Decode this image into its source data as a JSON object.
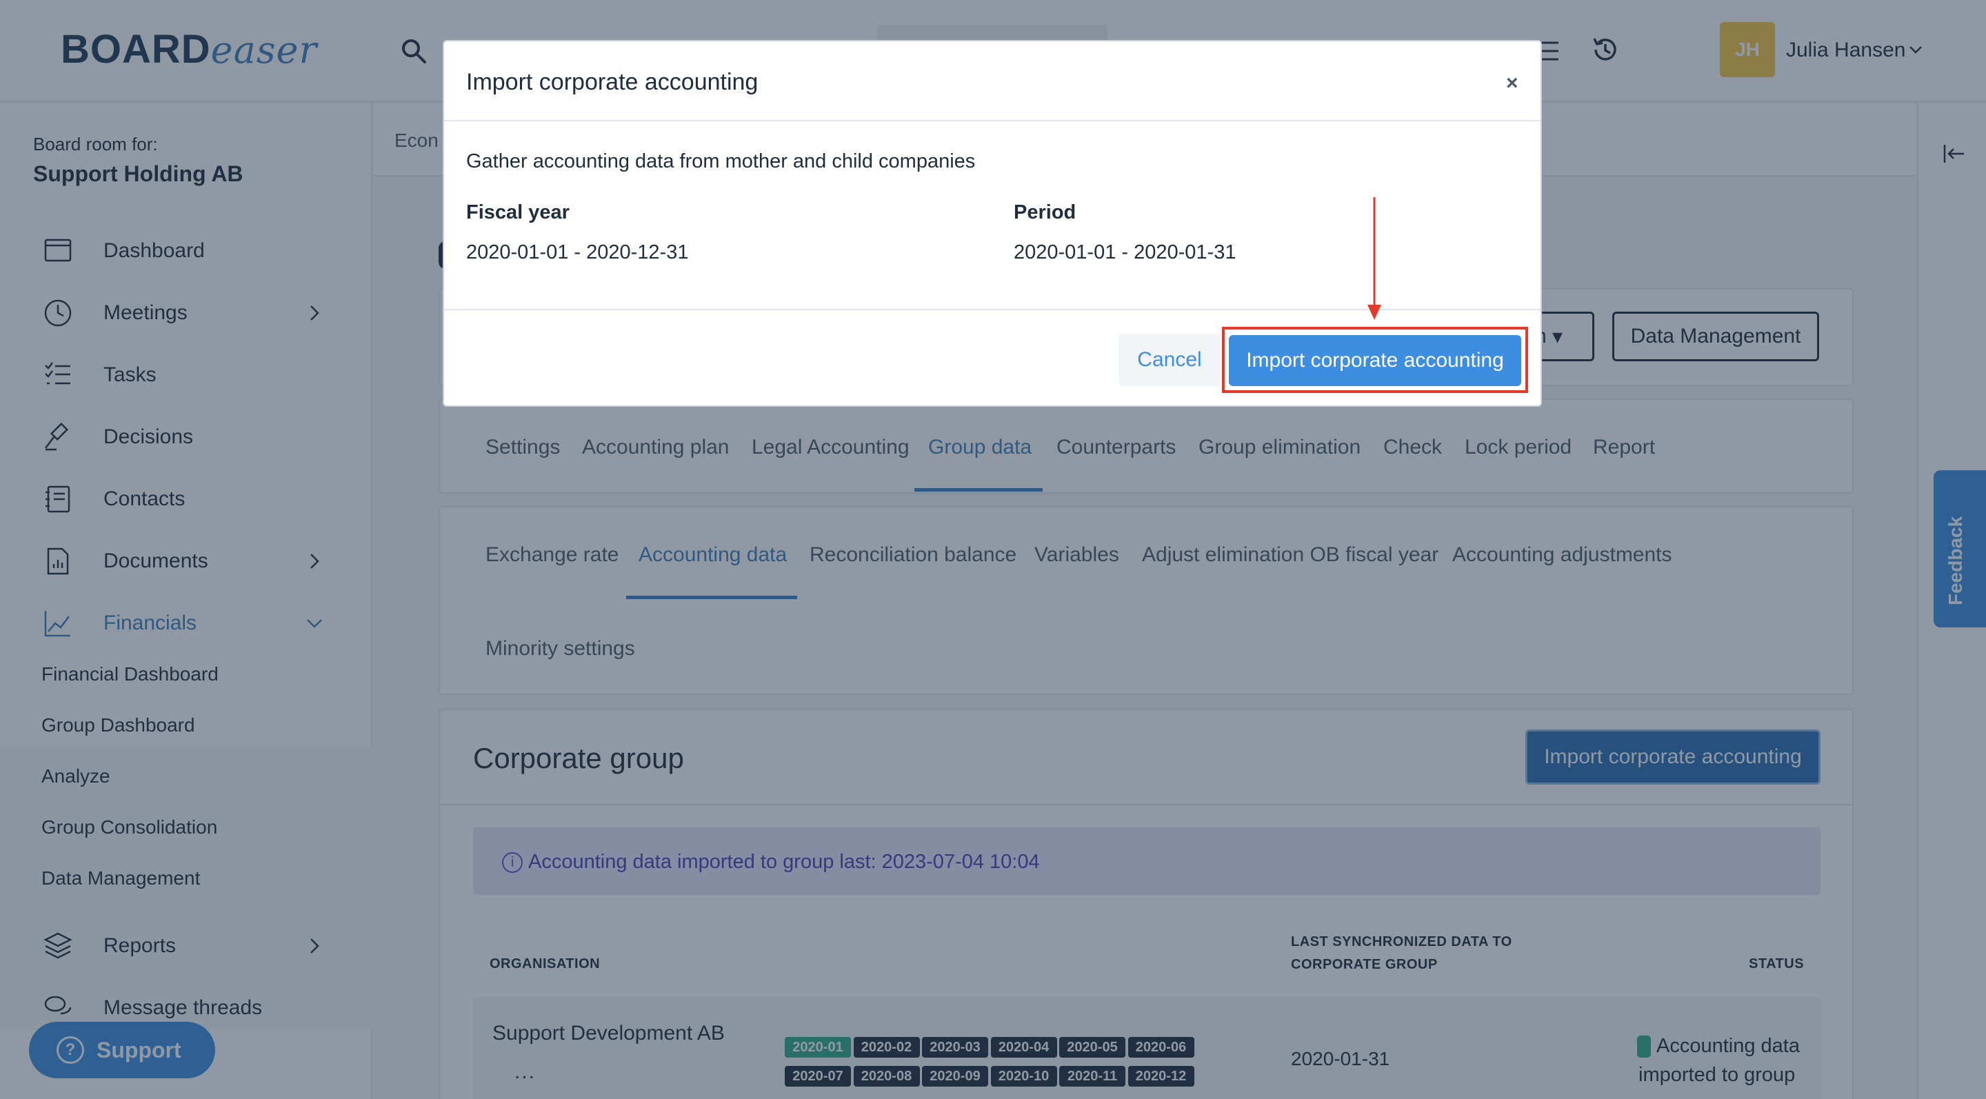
{
  "header": {
    "logo_board": "BOARD",
    "logo_easer": "easer",
    "user": {
      "initials": "JH",
      "name": "Julia Hansen"
    }
  },
  "sidebar": {
    "board_room_label": "Board room for:",
    "company": "Support Holding AB",
    "items": [
      {
        "label": "Dashboard"
      },
      {
        "label": "Meetings"
      },
      {
        "label": "Tasks"
      },
      {
        "label": "Decisions"
      },
      {
        "label": "Contacts"
      },
      {
        "label": "Documents"
      },
      {
        "label": "Financials"
      },
      {
        "label": "Reports"
      },
      {
        "label": "Message threads"
      }
    ],
    "financials_sub": [
      {
        "label": "Financial Dashboard"
      },
      {
        "label": "Group Dashboard"
      },
      {
        "label": "Analyze"
      },
      {
        "label": "Group Consolidation"
      },
      {
        "label": "Data Management"
      }
    ],
    "support_label": "Support"
  },
  "breadcrumb": {
    "text": "Econ"
  },
  "toolbar": {
    "dropdown_partial": "n",
    "data_management_label": "Data Management"
  },
  "main_tabs": [
    {
      "label": "Settings"
    },
    {
      "label": "Accounting plan"
    },
    {
      "label": "Legal Accounting"
    },
    {
      "label": "Group data"
    },
    {
      "label": "Counterparts"
    },
    {
      "label": "Group elimination"
    },
    {
      "label": "Check"
    },
    {
      "label": "Lock period"
    },
    {
      "label": "Report"
    }
  ],
  "sub_tabs": [
    {
      "label": "Exchange rate"
    },
    {
      "label": "Accounting data"
    },
    {
      "label": "Reconciliation balance"
    },
    {
      "label": "Variables"
    },
    {
      "label": "Adjust elimination OB fiscal year"
    },
    {
      "label": "Accounting adjustments"
    },
    {
      "label": "Minority settings"
    }
  ],
  "corporate_group": {
    "title": "Corporate group",
    "import_button": "Import corporate accounting",
    "info": "Accounting data imported to group last: 2023-07-04 10:04",
    "columns": {
      "organisation": "ORGANISATION",
      "last_sync_line1": "LAST SYNCHRONIZED DATA TO",
      "last_sync_line2": "CORPORATE GROUP",
      "status": "STATUS"
    },
    "rows": [
      {
        "organisation": "Support Development AB",
        "more": "...",
        "periods": [
          "2020-01",
          "2020-02",
          "2020-03",
          "2020-04",
          "2020-05",
          "2020-06",
          "2020-07",
          "2020-08",
          "2020-09",
          "2020-10",
          "2020-11",
          "2020-12"
        ],
        "active_period": "2020-01",
        "last_sync": "2020-01-31",
        "status": "Accounting data imported to group"
      }
    ]
  },
  "feedback": {
    "label": "Feedback"
  },
  "modal": {
    "title": "Import corporate accounting",
    "close": "×",
    "description": "Gather accounting data from mother and child companies",
    "fiscal_year_label": "Fiscal year",
    "fiscal_year_value": "2020-01-01 - 2020-12-31",
    "period_label": "Period",
    "period_value": "2020-01-01 - 2020-01-31",
    "cancel_label": "Cancel",
    "import_label": "Import corporate accounting"
  },
  "colors": {
    "primary": "#3d8de0",
    "primary_dark": "#2a6fb5",
    "active_period": "#2fa98a",
    "highlight": "#e53a2b",
    "info_bg": "#e6e6fa"
  }
}
